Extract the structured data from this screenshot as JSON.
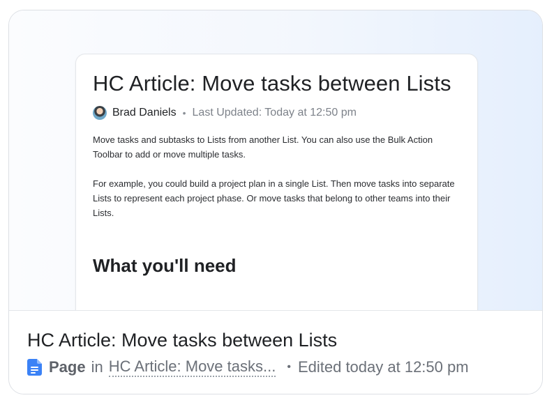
{
  "preview": {
    "doc_title": "HC Article: Move tasks between Lists",
    "author": "Brad Daniels",
    "separator": "•",
    "last_updated": "Last Updated: Today at 12:50 pm",
    "paragraph_1": "Move tasks and subtasks to Lists from another List. You can also use the Bulk Action Toolbar to add or move multiple tasks.",
    "paragraph_2": "For example, you could build a project plan in a single List. Then move tasks into separate Lists to represent each project phase. Or move tasks that belong to other teams into their Lists.",
    "section_heading": "What you'll need"
  },
  "footer": {
    "title": "HC Article: Move tasks between Lists",
    "icon": "document-icon",
    "type_label": "Page",
    "in_text": "in",
    "parent_link": "HC Article: Move tasks...",
    "separator": "•",
    "edited": "Edited today at 12:50 pm"
  },
  "colors": {
    "doc_icon": "#3b82f6",
    "text_primary": "#1f2124",
    "text_secondary": "#6b7078"
  }
}
